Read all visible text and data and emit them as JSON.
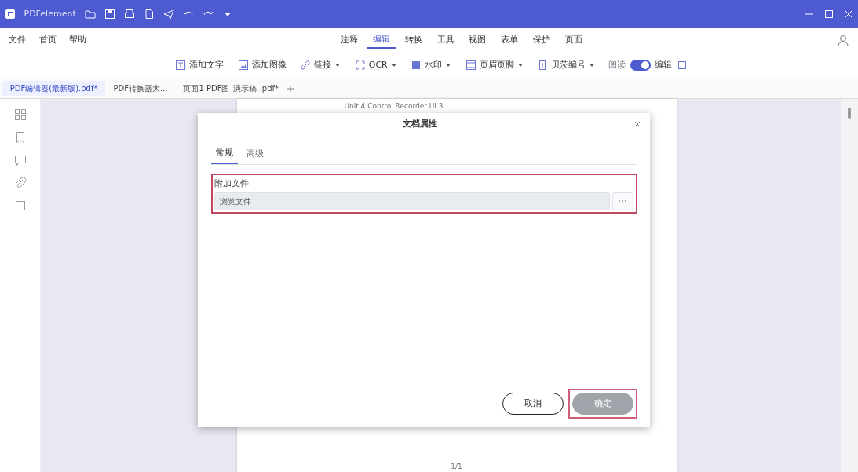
{
  "window": {
    "title": "PDFelement"
  },
  "menu": [
    "文件",
    "首页",
    "帮助"
  ],
  "ribbon_tabs": [
    {
      "label": "注释",
      "selected": false
    },
    {
      "label": "编辑",
      "selected": true
    },
    {
      "label": "转换",
      "selected": false
    },
    {
      "label": "工具",
      "selected": false
    },
    {
      "label": "视图",
      "selected": false
    },
    {
      "label": "表单",
      "selected": false
    },
    {
      "label": "保护",
      "selected": false
    },
    {
      "label": "页面",
      "selected": false
    }
  ],
  "toolbar": [
    {
      "label": "添加文字",
      "dropdown": false
    },
    {
      "label": "添加图像",
      "dropdown": false
    },
    {
      "label": "链接",
      "dropdown": true
    },
    {
      "label": "OCR",
      "dropdown": true
    },
    {
      "label": "水印",
      "dropdown": true
    },
    {
      "label": "页眉页脚",
      "dropdown": true
    },
    {
      "label": "贝茨编号",
      "dropdown": true
    }
  ],
  "mode_toggle": {
    "left": "阅读",
    "right": "编辑",
    "on": true
  },
  "doc_tabs": [
    {
      "label": "PDF编辑器(最新版).pdf*",
      "selected": true
    },
    {
      "label": "PDF转换器大...",
      "selected": false
    },
    {
      "label": "页面1 PDF图_演示稿 .pdf*",
      "selected": false
    }
  ],
  "document": {
    "header": "Unit 4 Control Recorder UI.3",
    "footer": "1/1"
  },
  "dialog": {
    "title": "文档属性",
    "tabs": [
      {
        "label": "常规",
        "selected": true
      },
      {
        "label": "高级",
        "selected": false
      }
    ],
    "field_label": "附加文件",
    "placeholder": "浏览文件",
    "buttons": [
      {
        "label": "取消",
        "kind": "secondary",
        "disabled": false
      },
      {
        "label": "确定",
        "kind": "primary",
        "disabled": true
      }
    ]
  }
}
